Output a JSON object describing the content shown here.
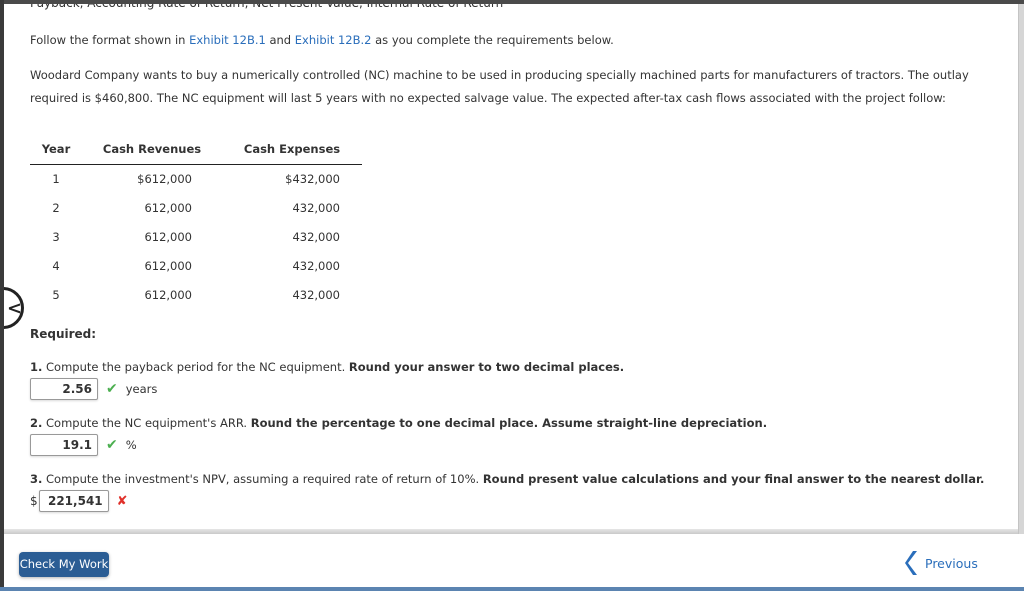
{
  "section_title": "Payback, Accounting Rate of Return, Net Present Value, Internal Rate of Return",
  "instructions": {
    "prefix": "Follow the format shown in ",
    "link1": "Exhibit 12B.1",
    "middle": " and ",
    "link2": "Exhibit 12B.2",
    "suffix": " as you complete the requirements below."
  },
  "problem_text": "Woodard Company wants to buy a numerically controlled (NC) machine to be used in producing specially machined parts for manufacturers of tractors. The outlay required is $460,800. The NC equipment will last 5 years with no expected salvage value. The expected after-tax cash flows associated with the project follow:",
  "table": {
    "headers": [
      "Year",
      "Cash Revenues",
      "Cash Expenses"
    ],
    "rows": [
      [
        "1",
        "$612,000",
        "$432,000"
      ],
      [
        "2",
        "612,000",
        "432,000"
      ],
      [
        "3",
        "612,000",
        "432,000"
      ],
      [
        "4",
        "612,000",
        "432,000"
      ],
      [
        "5",
        "612,000",
        "432,000"
      ]
    ]
  },
  "required_label": "Required:",
  "questions": [
    {
      "num": "1.",
      "text": " Compute the payback period for the NC equipment. ",
      "bold": "Round your answer to two decimal places.",
      "prefix": "",
      "answer": "2.56",
      "status": "correct",
      "status_icon": "✔",
      "unit": "years"
    },
    {
      "num": "2.",
      "text": " Compute the NC equipment's ARR. ",
      "bold": "Round the percentage to one decimal place. Assume straight-line depreciation.",
      "prefix": "",
      "answer": "19.1",
      "status": "correct",
      "status_icon": "✔",
      "unit": "%"
    },
    {
      "num": "3.",
      "text": " Compute the investment's NPV, assuming a required rate of return of 10%. ",
      "bold": "Round present value calculations and your final answer to the nearest dollar.",
      "prefix": "$",
      "answer": "221,541",
      "status": "incorrect",
      "status_icon": "✘",
      "unit": ""
    }
  ],
  "footer": {
    "check_button": "Check My Work",
    "previous_button": "Previous"
  },
  "nav": {
    "back_glyph": "<"
  },
  "colors": {
    "link": "#2a6ebb",
    "button": "#2b5d94",
    "correct": "#4caf50",
    "incorrect": "#e0302a"
  }
}
